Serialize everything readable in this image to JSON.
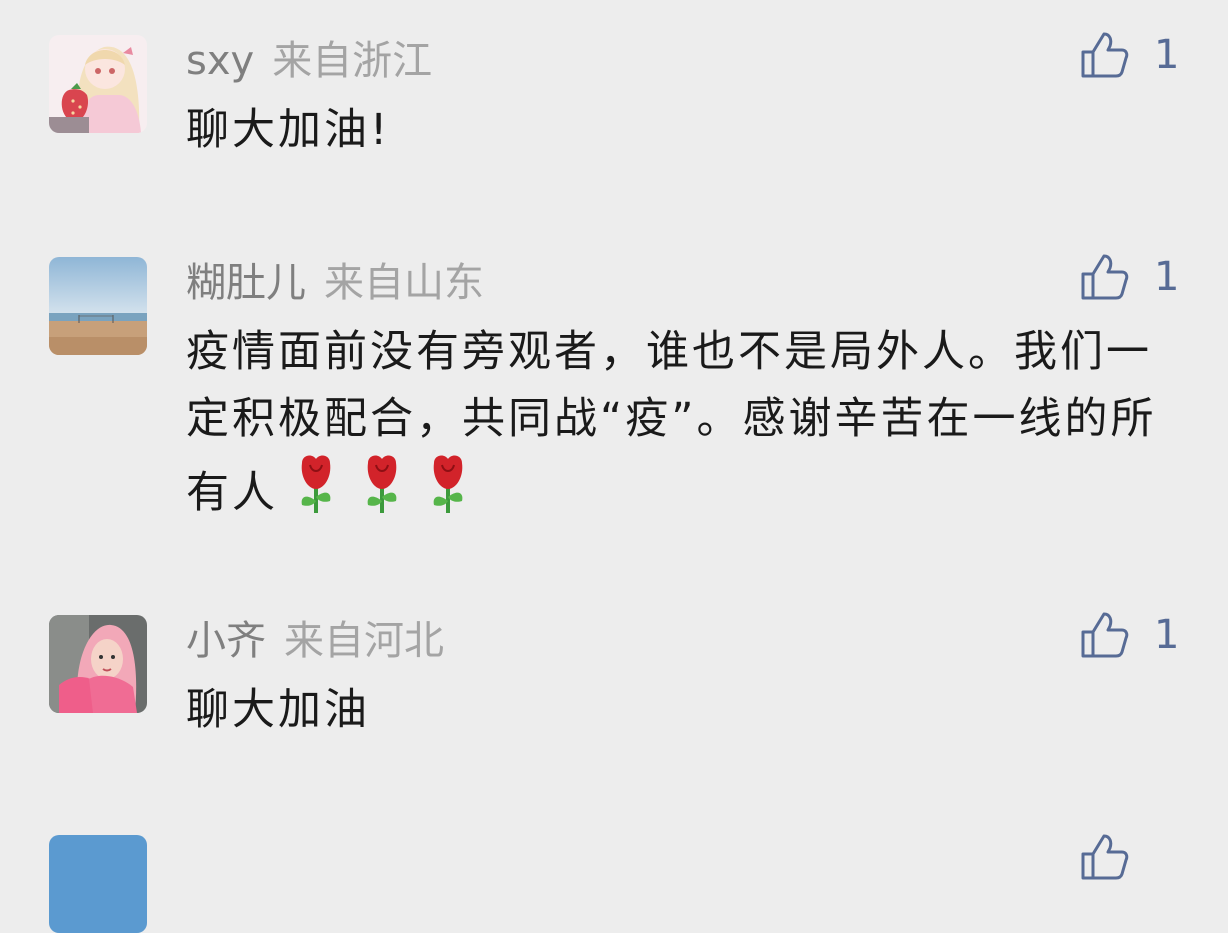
{
  "comments": [
    {
      "name": "sxy",
      "location": "来自浙江",
      "text": "聊大加油!",
      "likes": "1",
      "avatar": "anime-girl-strawberry-avatar"
    },
    {
      "name": "糊肚儿",
      "location": "来自山东",
      "text": "疫情面前没有旁观者，谁也不是局外人。我们一定积极配合，共同战“疫”。感谢辛苦在一线的所有人",
      "emojis": [
        "rose-emoji",
        "rose-emoji",
        "rose-emoji"
      ],
      "likes": "1",
      "avatar": "beach-photo-avatar"
    },
    {
      "name": "小齐",
      "location": "来自河北",
      "text": "聊大加油",
      "likes": "1",
      "avatar": "pink-hair-girl-avatar"
    }
  ],
  "colors": {
    "background": "#ededed",
    "like_blue": "#576b95",
    "name_gray": "#7f7f7f",
    "location_gray": "#a4a4a4",
    "text": "#1a1a1a"
  }
}
